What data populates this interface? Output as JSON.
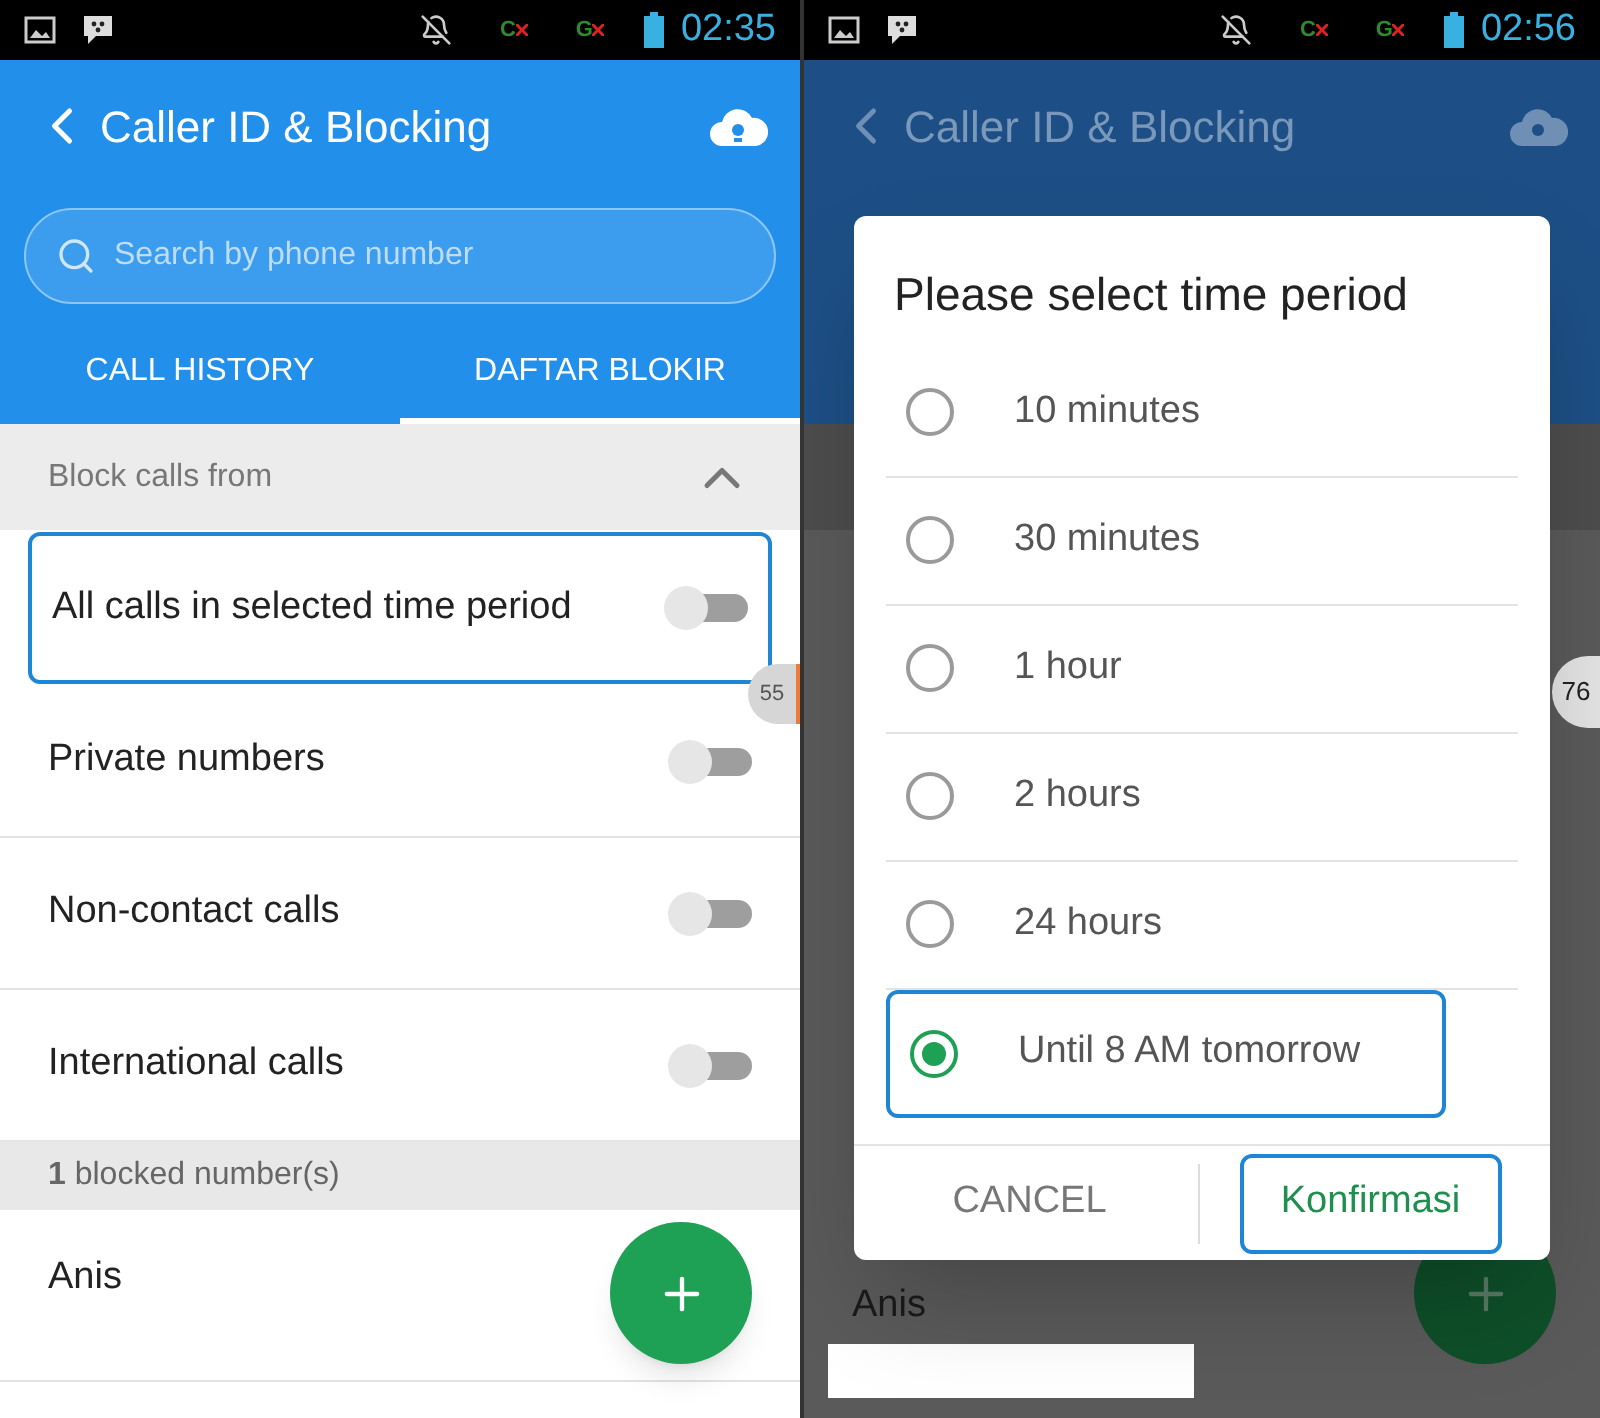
{
  "main_screen": {
    "status_bar": {
      "signals": [
        "C",
        "G"
      ],
      "time": "02:35"
    },
    "header": {
      "title": "Caller ID & Blocking"
    },
    "search": {
      "placeholder": "Search by phone number"
    },
    "tabs": [
      {
        "label": "CALL HISTORY",
        "selected": false
      },
      {
        "label": "DAFTAR BLOKIR",
        "selected": true
      }
    ],
    "section": {
      "title": "Block calls from",
      "expanded": true
    },
    "block_options": [
      {
        "label": "All calls in selected time period",
        "on": false,
        "focused": true
      },
      {
        "label": "Private numbers",
        "on": false,
        "focused": false
      },
      {
        "label": "Non-contact calls",
        "on": false,
        "focused": false
      },
      {
        "label": "International calls",
        "on": false,
        "focused": false
      }
    ],
    "blocked_header": "**1** blocked number(s)",
    "contacts": [
      {
        "name": "Anis"
      }
    ],
    "side_badge": "55"
  },
  "dialog_screen": {
    "status_bar": {
      "signals": [
        "C",
        "G"
      ],
      "time": "02:56"
    },
    "header": {
      "title": "Caller ID & Blocking"
    },
    "contacts": [
      {
        "name": "Anis"
      }
    ],
    "side_badge": "76",
    "dialog": {
      "title": "Please select time period",
      "options": [
        {
          "label": "10 minutes",
          "selected": false
        },
        {
          "label": "30 minutes",
          "selected": false
        },
        {
          "label": "1 hour",
          "selected": false
        },
        {
          "label": "2 hours",
          "selected": false
        },
        {
          "label": "24 hours",
          "selected": false
        },
        {
          "label": "Until 8 AM tomorrow",
          "selected": true
        }
      ],
      "buttons": [
        {
          "label": "CANCEL",
          "kind": "text",
          "focused": false
        },
        {
          "label": "Konfirmasi",
          "kind": "primary",
          "focused": true
        }
      ]
    }
  }
}
